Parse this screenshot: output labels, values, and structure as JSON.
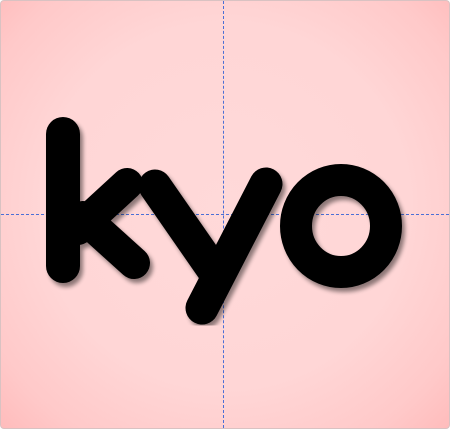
{
  "card": {
    "word": "kyo",
    "background_color": "#ffd6d6",
    "edge_color": "#ffbcbc",
    "guide_color": "#4a6fd6",
    "letter_color": "#000000"
  }
}
